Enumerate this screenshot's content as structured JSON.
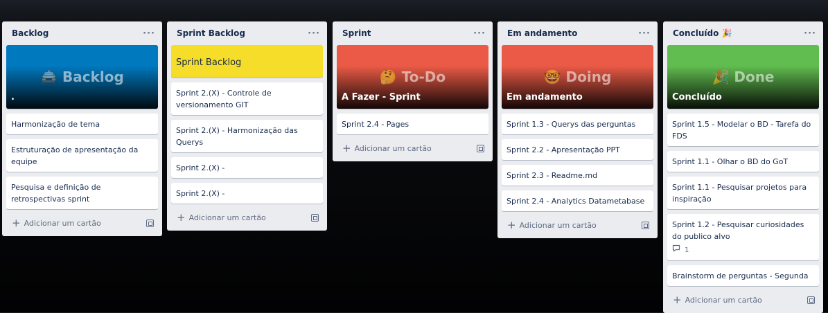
{
  "lists": [
    {
      "title": "Backlog",
      "more": "···",
      "cover": {
        "big": "🚔 Backlog",
        "title": ".",
        "color": "#0079bf"
      },
      "cards": [
        "Harmonização de tema",
        "Estruturação de apresentação da equipe",
        "Pesquisa e definição de retrospectivas sprint"
      ],
      "add_label": "Adicionar um cartão"
    },
    {
      "title": "Sprint Backlog",
      "more": "···",
      "cover": {
        "title": "Sprint Backlog",
        "color": "#f5dd29"
      },
      "cards": [
        "Sprint 2.(X) - Controle de versionamento GIT",
        "Sprint 2.(X) - Harmonização das Querys",
        "Sprint 2.(X) -",
        "Sprint 2.(X) -"
      ],
      "add_label": "Adicionar um cartão"
    },
    {
      "title": "Sprint",
      "more": "···",
      "cover": {
        "big": "🤔 To-Do",
        "title": "A Fazer - Sprint",
        "color": "#eb5a46"
      },
      "cards": [
        "Sprint 2.4 - Pages"
      ],
      "add_label": "Adicionar um cartão"
    },
    {
      "title": "Em andamento",
      "more": "···",
      "cover": {
        "big": "🤓 Doing",
        "title": "Em andamento",
        "color": "#eb5a46"
      },
      "cards": [
        "Sprint 1.3 - Querys das perguntas",
        "Sprint 2.2 - Apresentação PPT",
        "Sprint 2.3 - Readme.md",
        "Sprint 2.4 - Analytics Datametabase"
      ],
      "add_label": "Adicionar um cartão"
    },
    {
      "title": "Concluído 🎉",
      "more": "···",
      "cover": {
        "big": "🎉 Done",
        "title": "Concluído",
        "color": "#61bd4f"
      },
      "cards": [
        "Sprint 1.5 - Modelar o BD - Tarefa do FDS",
        "Sprint 1.1 - Olhar o BD do GoT",
        "Sprint 1.1 - Pesquisar projetos para inspiração",
        "Sprint 1.2 - Pesquisar curiosidades do publico alvo",
        "Brainstorm de perguntas - Segunda"
      ],
      "comment_count": "1",
      "add_label": "Adicionar um cartão"
    }
  ]
}
